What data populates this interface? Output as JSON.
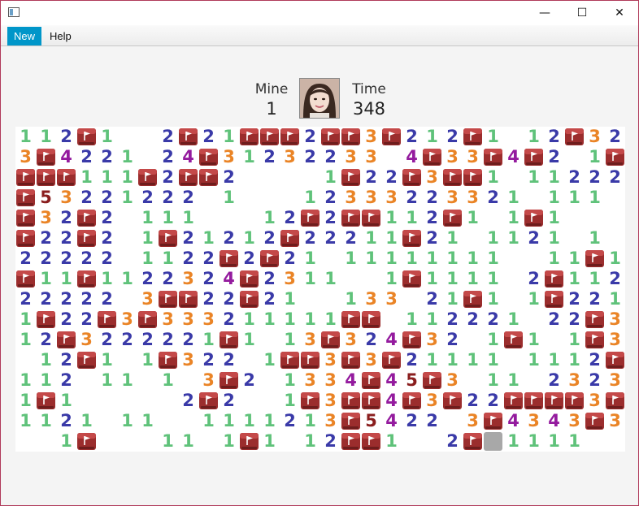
{
  "window": {
    "controls": {
      "minimize": "—",
      "maximize": "☐",
      "close": "✕"
    }
  },
  "menu": [
    {
      "label": "New",
      "active": true
    },
    {
      "label": "Help",
      "active": false
    }
  ],
  "status": {
    "mine_label": "Mine",
    "mine_value": "1",
    "time_label": "Time",
    "time_value": "348"
  },
  "board": {
    "columns": 30,
    "rows": 16,
    "legend": "digits = adjacent mine count, F = flag, . = revealed empty, H = hidden",
    "grid": [
      "112F1  2F21FFF2FF3F212F1 12F32",
      "3F4221 24F31232233 4F33F4F2 1F3FF",
      "FFF111F2FF2    1F22F3FF1 11222",
      "F53221222 1   12333223321 111",
      "F32F2 111   12F2FF112F1 1F1",
      "F22F2 1F21212F22211F21 1121 1",
      "22222 1122F2F21 11111111  11F1",
      "F11F1122324F2311  1F1111 2F1122",
      "22222 3FF22F21  133 21F1 1F221F",
      "1F22F3F333211111FF 112221 22F32",
      "12F3222221F1 13F324F32 1F1 1F34F",
      " 12F1 1F322 1FF3F3F21111 1112FF",
      "112 11 1 3F2 1334F45F3 11 23234F",
      "1F1     2F2  1F3FF4F3F22FFFF3F2",
      "1121 11  1111213F5422 3F4343F311",
      "  1F   11 1F1 12FF1  2FH1111  "
    ]
  }
}
